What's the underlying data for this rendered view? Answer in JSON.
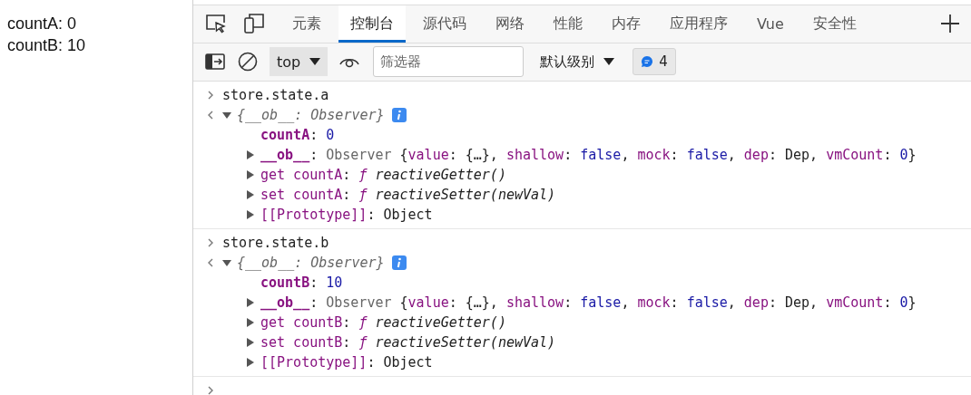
{
  "page": {
    "lines": [
      "countA: 0",
      "countB: 10"
    ]
  },
  "devtools": {
    "tabs": [
      {
        "label": "元素",
        "selected": false
      },
      {
        "label": "控制台",
        "selected": true
      },
      {
        "label": "源代码",
        "selected": false
      },
      {
        "label": "网络",
        "selected": false
      },
      {
        "label": "性能",
        "selected": false
      },
      {
        "label": "内存",
        "selected": false
      },
      {
        "label": "应用程序",
        "selected": false
      },
      {
        "label": "Vue",
        "selected": false
      },
      {
        "label": "安全性",
        "selected": false
      }
    ],
    "toolbar": {
      "context": "top",
      "filter_placeholder": "筛选器",
      "level": "默认级别",
      "message_count": "4"
    },
    "console": [
      {
        "input": "store.state.a",
        "output": {
          "summary": "{__ob__: Observer}",
          "expanded": true,
          "properties": [
            {
              "expandable": false,
              "parts": [
                {
                  "text": "countA",
                  "kind": "own"
                },
                {
                  "text": ": ",
                  "kind": "punct"
                },
                {
                  "text": "0",
                  "kind": "number"
                }
              ]
            },
            {
              "expandable": true,
              "parts": [
                {
                  "text": "__ob__",
                  "kind": "own"
                },
                {
                  "text": ": ",
                  "kind": "punct"
                },
                {
                  "text": "Observer ",
                  "kind": "class"
                },
                {
                  "text": "{",
                  "kind": "punct"
                },
                {
                  "text": "value",
                  "kind": "key"
                },
                {
                  "text": ": {…}, ",
                  "kind": "punct"
                },
                {
                  "text": "shallow",
                  "kind": "key"
                },
                {
                  "text": ": ",
                  "kind": "punct"
                },
                {
                  "text": "false",
                  "kind": "bool"
                },
                {
                  "text": ", ",
                  "kind": "punct"
                },
                {
                  "text": "mock",
                  "kind": "key"
                },
                {
                  "text": ": ",
                  "kind": "punct"
                },
                {
                  "text": "false",
                  "kind": "bool"
                },
                {
                  "text": ", ",
                  "kind": "punct"
                },
                {
                  "text": "dep",
                  "kind": "key"
                },
                {
                  "text": ": Dep, ",
                  "kind": "punct"
                },
                {
                  "text": "vmCount",
                  "kind": "key"
                },
                {
                  "text": ": ",
                  "kind": "punct"
                },
                {
                  "text": "0",
                  "kind": "number"
                },
                {
                  "text": "}",
                  "kind": "punct"
                }
              ]
            },
            {
              "expandable": true,
              "parts": [
                {
                  "text": "get countA",
                  "kind": "accessor"
                },
                {
                  "text": ": ",
                  "kind": "punct"
                },
                {
                  "text": "ƒ ",
                  "kind": "func"
                },
                {
                  "text": "reactiveGetter()",
                  "kind": "func"
                }
              ]
            },
            {
              "expandable": true,
              "parts": [
                {
                  "text": "set countA",
                  "kind": "accessor"
                },
                {
                  "text": ": ",
                  "kind": "punct"
                },
                {
                  "text": "ƒ ",
                  "kind": "func"
                },
                {
                  "text": "reactiveSetter(newVal)",
                  "kind": "func"
                }
              ]
            },
            {
              "expandable": true,
              "parts": [
                {
                  "text": "[[Prototype]]",
                  "kind": "accessor"
                },
                {
                  "text": ": ",
                  "kind": "punct"
                },
                {
                  "text": "Object",
                  "kind": "plain"
                }
              ]
            }
          ]
        }
      },
      {
        "input": "store.state.b",
        "output": {
          "summary": "{__ob__: Observer}",
          "expanded": true,
          "properties": [
            {
              "expandable": false,
              "parts": [
                {
                  "text": "countB",
                  "kind": "own"
                },
                {
                  "text": ": ",
                  "kind": "punct"
                },
                {
                  "text": "10",
                  "kind": "number"
                }
              ]
            },
            {
              "expandable": true,
              "parts": [
                {
                  "text": "__ob__",
                  "kind": "own"
                },
                {
                  "text": ": ",
                  "kind": "punct"
                },
                {
                  "text": "Observer ",
                  "kind": "class"
                },
                {
                  "text": "{",
                  "kind": "punct"
                },
                {
                  "text": "value",
                  "kind": "key"
                },
                {
                  "text": ": {…}, ",
                  "kind": "punct"
                },
                {
                  "text": "shallow",
                  "kind": "key"
                },
                {
                  "text": ": ",
                  "kind": "punct"
                },
                {
                  "text": "false",
                  "kind": "bool"
                },
                {
                  "text": ", ",
                  "kind": "punct"
                },
                {
                  "text": "mock",
                  "kind": "key"
                },
                {
                  "text": ": ",
                  "kind": "punct"
                },
                {
                  "text": "false",
                  "kind": "bool"
                },
                {
                  "text": ", ",
                  "kind": "punct"
                },
                {
                  "text": "dep",
                  "kind": "key"
                },
                {
                  "text": ": Dep, ",
                  "kind": "punct"
                },
                {
                  "text": "vmCount",
                  "kind": "key"
                },
                {
                  "text": ": ",
                  "kind": "punct"
                },
                {
                  "text": "0",
                  "kind": "number"
                },
                {
                  "text": "}",
                  "kind": "punct"
                }
              ]
            },
            {
              "expandable": true,
              "parts": [
                {
                  "text": "get countB",
                  "kind": "accessor"
                },
                {
                  "text": ": ",
                  "kind": "punct"
                },
                {
                  "text": "ƒ ",
                  "kind": "func"
                },
                {
                  "text": "reactiveGetter()",
                  "kind": "func"
                }
              ]
            },
            {
              "expandable": true,
              "parts": [
                {
                  "text": "set countB",
                  "kind": "accessor"
                },
                {
                  "text": ": ",
                  "kind": "punct"
                },
                {
                  "text": "ƒ ",
                  "kind": "func"
                },
                {
                  "text": "reactiveSetter(newVal)",
                  "kind": "func"
                }
              ]
            },
            {
              "expandable": true,
              "parts": [
                {
                  "text": "[[Prototype]]",
                  "kind": "accessor"
                },
                {
                  "text": ": ",
                  "kind": "punct"
                },
                {
                  "text": "Object",
                  "kind": "plain"
                }
              ]
            }
          ]
        }
      }
    ]
  }
}
